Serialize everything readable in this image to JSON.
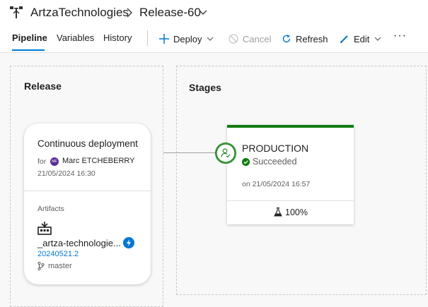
{
  "breadcrumb": {
    "project": "ArtzaTechnologies",
    "release": "Release-60"
  },
  "tabs": [
    {
      "label": "Pipeline",
      "active": true
    },
    {
      "label": "Variables",
      "active": false
    },
    {
      "label": "History",
      "active": false
    }
  ],
  "toolbar": {
    "deploy_label": "Deploy",
    "cancel_label": "Cancel",
    "refresh_label": "Refresh",
    "edit_label": "Edit",
    "more_label": "···"
  },
  "release_panel": {
    "title": "Release",
    "trigger": {
      "title": "Continuous deployment",
      "for_label": "for",
      "avatar_initials": "ME",
      "user": "Marc ETCHEBERRY",
      "date": "21/05/2024 16:30"
    },
    "artifacts": {
      "label": "Artifacts",
      "name": "_artza-technologie...",
      "build": "20240521.2",
      "branch": "master"
    }
  },
  "stages_panel": {
    "title": "Stages",
    "stage": {
      "name": "PRODUCTION",
      "status": "Succeeded",
      "date": "on 21/05/2024 16:57",
      "tests_percent": "100%"
    }
  },
  "colors": {
    "accent": "#0078d4",
    "success": "#107c10",
    "avatar": "#5c2e91"
  },
  "icons": [
    "pipeline-icon",
    "plus-icon",
    "cancel-icon",
    "refresh-icon",
    "edit-icon",
    "chevron-down-icon",
    "build-artifact-icon",
    "trigger-icon",
    "branch-icon",
    "approver-icon",
    "check-icon",
    "flask-icon"
  ]
}
